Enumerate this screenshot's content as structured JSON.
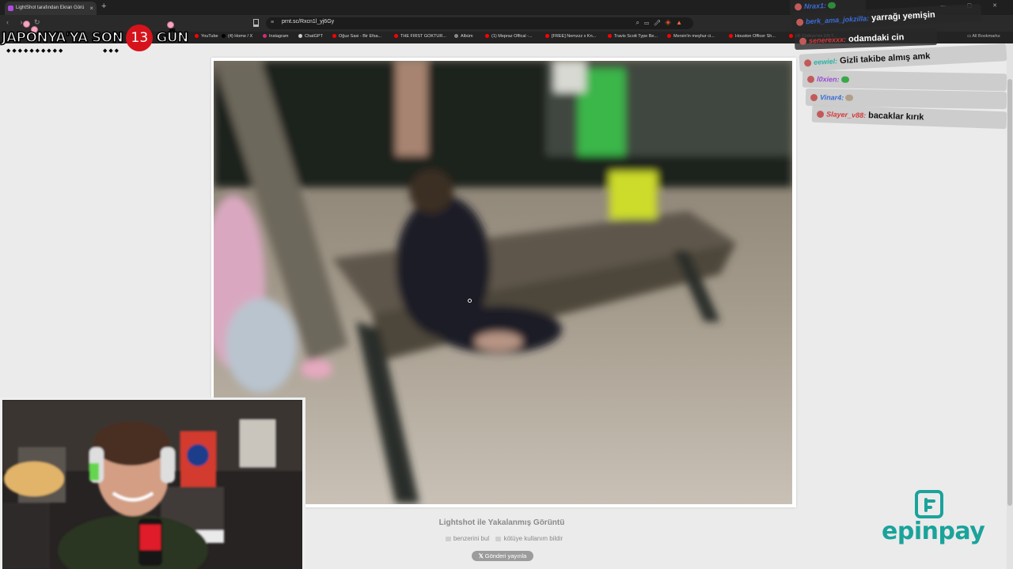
{
  "browser": {
    "tab_title": "LightShot tarafından Ekran Görü",
    "tab_close": "×",
    "new_tab": "+",
    "window_controls": "— ▢ ✕",
    "nav_buttons": "‹ › ↻",
    "url": "prnt.sc/Rxcn1l_yj6Gy",
    "bookmarks": [
      {
        "label": "YouTube",
        "color": "#ff0000"
      },
      {
        "label": "(4) Home / X",
        "color": "#000000"
      },
      {
        "label": "Instagram",
        "color": "#d62976"
      },
      {
        "label": "ChatGPT",
        "color": "#cccccc"
      },
      {
        "label": "Oğuz Sasi - Bir Efsa...",
        "color": "#ff0000"
      },
      {
        "label": "THE FIRST GOKTUR...",
        "color": "#ff0000"
      },
      {
        "label": "Albüm",
        "color": "#888888"
      },
      {
        "label": "(1) Mepraz Offical -...",
        "color": "#ff0000"
      },
      {
        "label": "[FREE] Nemzzz x Kn...",
        "color": "#ff0000"
      },
      {
        "label": "Travis Scott Type Be...",
        "color": "#ff0000"
      },
      {
        "label": "Mersin'in meşhur ci...",
        "color": "#ff0000"
      },
      {
        "label": "Houston Officer Sh...",
        "color": "#ff0000"
      },
      {
        "label": "(4) Türkiye'nin EN T...",
        "color": "#ff0000"
      }
    ],
    "all_bookmarks": "All Bookmarks"
  },
  "countdown": {
    "prefix": "JAPONYA'YA SON",
    "days": "13",
    "suffix": "GÜN",
    "accent": "#d6131c"
  },
  "page": {
    "caption": "Lightshot ile Yakalanmış Görüntü",
    "link_similar": "benzerini bul",
    "link_report": "kötüye kullanım bildir",
    "share_label": "Gönderi yayınla"
  },
  "chat": [
    {
      "user": "Nrax1:",
      "message": "",
      "user_color": "#3a6cd6",
      "emote": "#2e8b3a"
    },
    {
      "user": "berk_ama_jokzilla:",
      "message": "yarrağı yemişin",
      "user_color": "#3a6cd6",
      "emote": ""
    },
    {
      "user": "senerexxx:",
      "message": "odamdaki cin",
      "user_color": "#d43a3a",
      "emote": ""
    },
    {
      "user": "eewiel:",
      "message": "Gizli takibe almış amk",
      "user_color": "#2bb3a3",
      "emote": ""
    },
    {
      "user": "l0xien:",
      "message": "",
      "user_color": "#9a4ad6",
      "emote": "#3aa84a"
    },
    {
      "user": "Vinar4:",
      "message": "",
      "user_color": "#3a6cd6",
      "emote": "#b0a08a"
    },
    {
      "user": "Slayer_v88:",
      "message": "bacaklar kırık",
      "user_color": "#d43a3a",
      "emote": ""
    }
  ],
  "sponsor": {
    "name": "epinpay",
    "color": "#1aa39b"
  }
}
